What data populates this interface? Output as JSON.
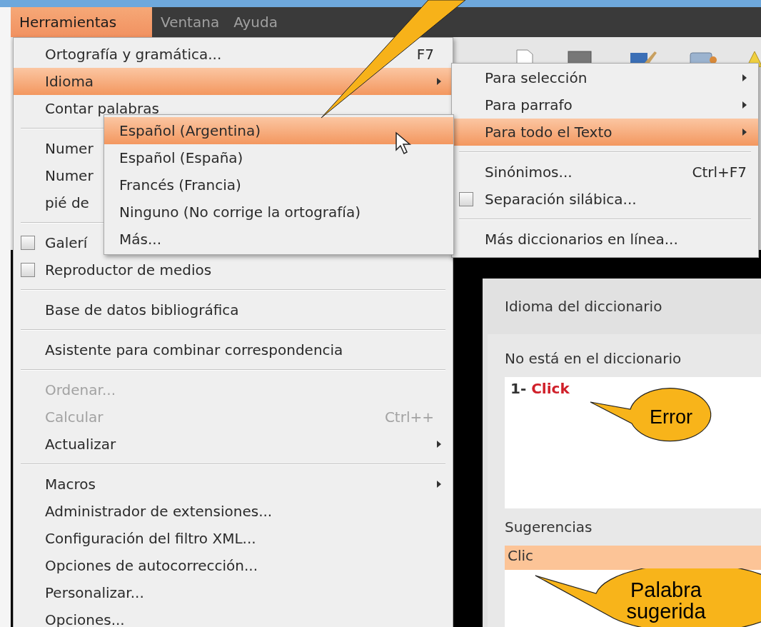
{
  "menu_bar": [
    {
      "label": "Herramientas",
      "selected": true
    },
    {
      "label": "Ventana",
      "selected": false
    },
    {
      "label": "Ayuda",
      "selected": false
    }
  ],
  "tools_menu": {
    "items": [
      {
        "kind": "command",
        "label": "Ortografía y gramática...",
        "shortcut": "F7",
        "selected": false,
        "disabled": false
      },
      {
        "kind": "command",
        "label": "Idioma",
        "has_submenu": true,
        "selected": true,
        "disabled": false
      },
      {
        "kind": "command",
        "label": "Contar palabras",
        "selected": false,
        "disabled": false
      },
      {
        "kind": "separator"
      },
      {
        "kind": "command",
        "label": "Numer",
        "selected": false,
        "disabled": false
      },
      {
        "kind": "command",
        "label": "Numer",
        "selected": false,
        "disabled": false
      },
      {
        "kind": "command",
        "label": "pié de",
        "selected": false,
        "disabled": false
      },
      {
        "kind": "separator"
      },
      {
        "kind": "checkbox",
        "label": "Galerí",
        "checked": false,
        "selected": false,
        "disabled": false
      },
      {
        "kind": "checkbox",
        "label": "Reproductor de medios",
        "checked": false,
        "selected": false,
        "disabled": false
      },
      {
        "kind": "separator"
      },
      {
        "kind": "command",
        "label": "Base de datos bibliográfica",
        "selected": false,
        "disabled": false
      },
      {
        "kind": "separator"
      },
      {
        "kind": "command",
        "label": "Asistente para combinar correspondencia",
        "selected": false,
        "disabled": false
      },
      {
        "kind": "separator"
      },
      {
        "kind": "command",
        "label": "Ordenar...",
        "selected": false,
        "disabled": true
      },
      {
        "kind": "command",
        "label": "Calcular",
        "shortcut": "Ctrl++",
        "selected": false,
        "disabled": true
      },
      {
        "kind": "command",
        "label": "Actualizar",
        "has_submenu": true,
        "selected": false,
        "disabled": false
      },
      {
        "kind": "separator"
      },
      {
        "kind": "command",
        "label": "Macros",
        "has_submenu": true,
        "selected": false,
        "disabled": false
      },
      {
        "kind": "command",
        "label": "Administrador de extensiones...",
        "selected": false,
        "disabled": false
      },
      {
        "kind": "command",
        "label": "Configuración del filtro XML...",
        "selected": false,
        "disabled": false
      },
      {
        "kind": "command",
        "label": "Opciones de autocorrección...",
        "selected": false,
        "disabled": false
      },
      {
        "kind": "command",
        "label": "Personalizar...",
        "selected": false,
        "disabled": false
      },
      {
        "kind": "command",
        "label": "Opciones...",
        "selected": false,
        "disabled": false
      }
    ]
  },
  "language_submenu": {
    "items": [
      {
        "kind": "command",
        "label": "Para selección",
        "has_submenu": true,
        "selected": false,
        "disabled": false
      },
      {
        "kind": "command",
        "label": "Para parrafo",
        "has_submenu": true,
        "selected": false,
        "disabled": false
      },
      {
        "kind": "command",
        "label": "Para todo el Texto",
        "has_submenu": true,
        "selected": true,
        "disabled": false
      },
      {
        "kind": "separator"
      },
      {
        "kind": "command",
        "label": "Sinónimos...",
        "shortcut": "Ctrl+F7",
        "selected": false,
        "disabled": false
      },
      {
        "kind": "checkbox",
        "label": "Separación silábica...",
        "checked": false,
        "selected": false,
        "disabled": false
      },
      {
        "kind": "separator"
      },
      {
        "kind": "command",
        "label": "Más diccionarios en línea...",
        "selected": false,
        "disabled": false
      }
    ]
  },
  "text_language_submenu": {
    "items": [
      {
        "label": "Español (Argentina)",
        "selected": true,
        "disabled": false
      },
      {
        "label": "Español (España)",
        "selected": false,
        "disabled": false
      },
      {
        "label": "Francés (Francia)",
        "selected": false,
        "disabled": false
      },
      {
        "label": "Ninguno (No corrige la ortografía)",
        "selected": false,
        "disabled": false
      },
      {
        "label": "Más...",
        "selected": false,
        "disabled": false
      }
    ]
  },
  "spelling_dialog": {
    "dictionary_language_label": "Idioma del diccionario",
    "not_in_dictionary_label": "No está en el diccionario",
    "sentence": "1- **Click**",
    "suggestions_label": "Sugerencias",
    "suggestions": [
      {
        "label": "Clic",
        "selected": true
      }
    ]
  },
  "callouts": [
    {
      "lines": [
        "Error"
      ]
    },
    {
      "lines": [
        "Palabra",
        "sugerida"
      ]
    }
  ]
}
